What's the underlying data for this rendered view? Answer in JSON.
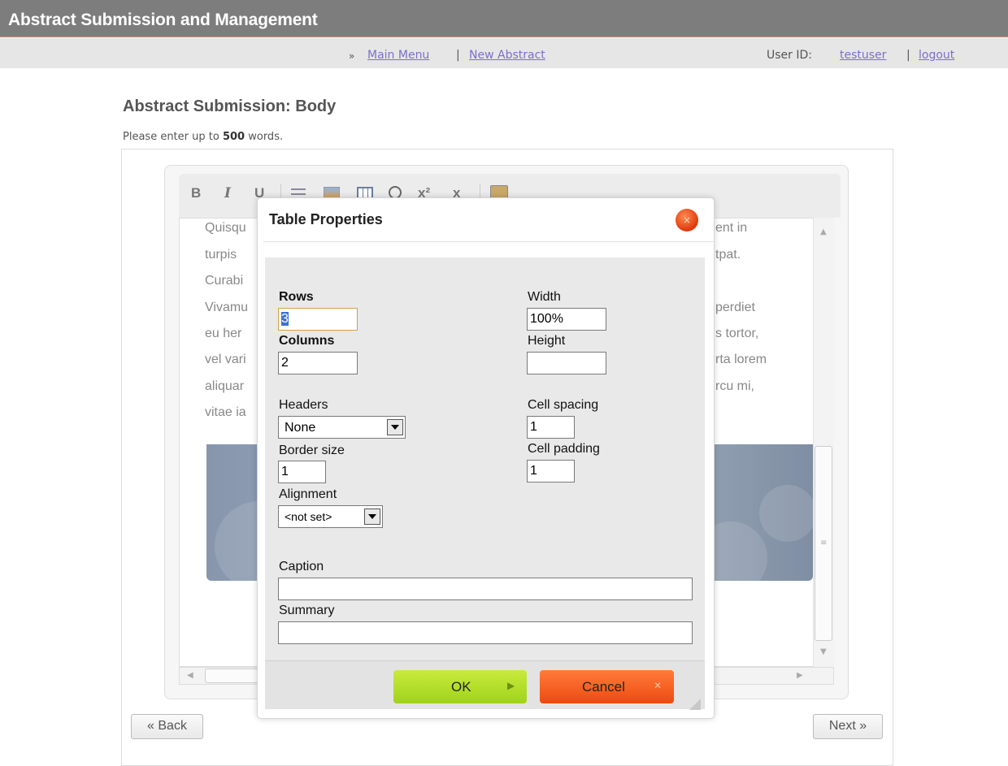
{
  "header": {
    "title": "Abstract Submission and Management"
  },
  "nav": {
    "prefix": "»",
    "main_menu": "Main Menu",
    "separator": "|",
    "new_abstract": "New Abstract",
    "user_label": "User ID:",
    "user_name": "testuser",
    "logout": "logout"
  },
  "page": {
    "title": "Abstract Submission: Body",
    "instruction_pre": "Please enter up to",
    "word_limit": "500",
    "instruction_post": "words."
  },
  "editor": {
    "toolbar_icons": [
      "bold-icon",
      "italic-icon",
      "underline-icon",
      "list-icon",
      "image-icon",
      "table-icon",
      "special-char-icon",
      "superscript-icon",
      "subscript-icon",
      "paste-icon"
    ],
    "toolbar_glyphs": {
      "bold": "B",
      "italic": "I",
      "underline": "U",
      "superscript": "x²",
      "subscript": "x"
    },
    "text_left": [
      "Quisqu",
      "turpis",
      "Curabi",
      "Vivamu",
      "eu her",
      "vel vari",
      "aliquar",
      "vitae ia"
    ],
    "text_right": [
      "ent in",
      "tpat.",
      "",
      "perdiet",
      "s tortor,",
      "rta lorem",
      "rcu mi,",
      ""
    ]
  },
  "dialog": {
    "title": "Table Properties",
    "close_glyph": "×",
    "rows_label": "Rows",
    "rows_value": "3",
    "columns_label": "Columns",
    "columns_value": "2",
    "width_label": "Width",
    "width_value": "100%",
    "height_label": "Height",
    "height_value": "",
    "headers_label": "Headers",
    "headers_value": "None",
    "cell_spacing_label": "Cell spacing",
    "cell_spacing_value": "1",
    "border_size_label": "Border size",
    "border_size_value": "1",
    "cell_padding_label": "Cell padding",
    "cell_padding_value": "1",
    "alignment_label": "Alignment",
    "alignment_value": "<not set>",
    "caption_label": "Caption",
    "caption_value": "",
    "summary_label": "Summary",
    "summary_value": "",
    "ok_label": "OK",
    "cancel_label": "Cancel"
  },
  "footer": {
    "back_label": "« Back",
    "next_label": "Next »"
  },
  "colors": {
    "header_bg": "#7d7d7d",
    "link": "#7b6fcc",
    "ok": "#a7d624",
    "cancel": "#f05a1a"
  }
}
